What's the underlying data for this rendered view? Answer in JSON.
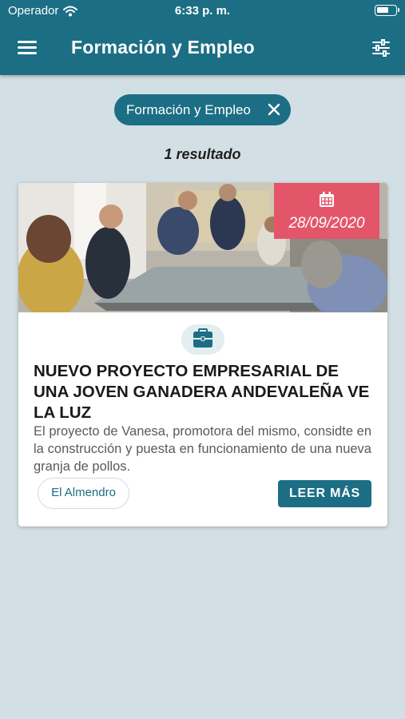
{
  "statusbar": {
    "carrier": "Operador",
    "time": "6:33 p. m."
  },
  "header": {
    "title": "Formación y Empleo",
    "menu_icon": "hamburger-icon",
    "filter_icon": "sliders-icon"
  },
  "filter_chip": {
    "label": "Formación y Empleo",
    "close_icon": "close-icon"
  },
  "results_count": "1 resultado",
  "card": {
    "date": "28/09/2020",
    "date_icon": "calendar-icon",
    "category_icon": "briefcase-icon",
    "title": "NUEVO PROYECTO EMPRESARIAL DE UNA JOVEN GANADERA ANDEVALEÑA VE LA LUZ",
    "summary": "El proyecto de Vanesa, promotora del mismo, considte en la construcción y puesta en funcionamiento de una nueva granja de pollos.",
    "tag": "El Almendro",
    "read_more": "LEER MÁS"
  },
  "colors": {
    "primary": "#1c6e84",
    "background": "#d2dfe4",
    "date_badge": "#e3566a"
  }
}
